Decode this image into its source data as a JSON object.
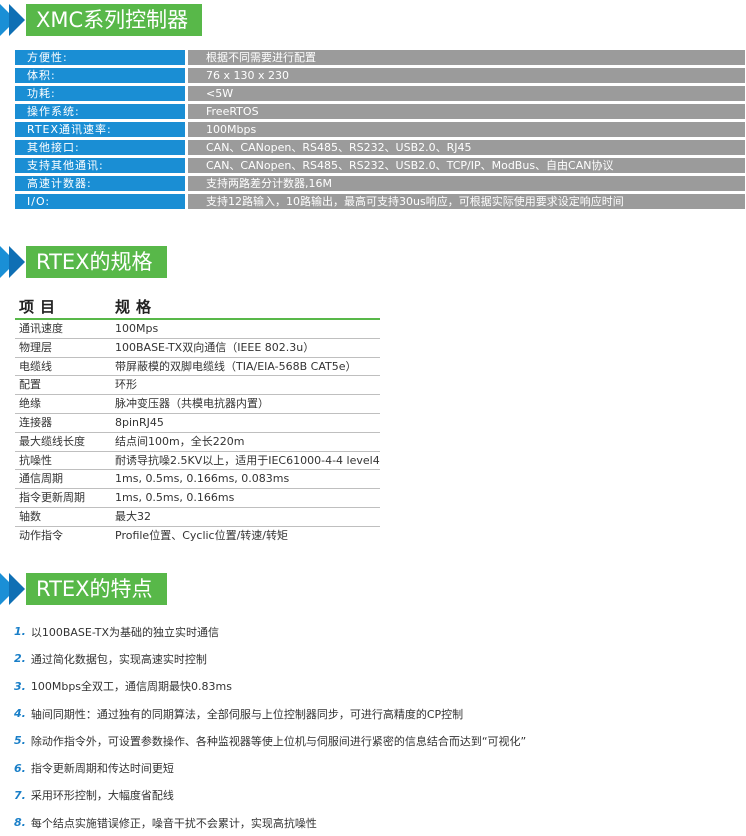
{
  "sections": {
    "xmc_title": "XMC系列控制器",
    "rtex_spec_title": "RTEX的规格",
    "rtex_feature_title": "RTEX的特点"
  },
  "specs": [
    {
      "key": "方便性:",
      "value": "根据不同需要进行配置"
    },
    {
      "key": "体积:",
      "value": "76 x 130 x 230"
    },
    {
      "key": "功耗:",
      "value": "<5W"
    },
    {
      "key": "操作系统:",
      "value": "FreeRTOS"
    },
    {
      "key": "RTEX通讯速率:",
      "value": "100Mbps"
    },
    {
      "key": "其他接口:",
      "value": "CAN、CANopen、RS485、RS232、USB2.0、RJ45"
    },
    {
      "key": "支持其他通讯:",
      "value": "CAN、CANopen、RS485、RS232、USB2.0、TCP/IP、ModBus、自由CAN协议"
    },
    {
      "key": "高速计数器:",
      "value": "支持两路差分计数器,16M"
    },
    {
      "key": "I/O:",
      "value": "支持12路输入，10路输出，最高可支持30us响应，可根据实际使用要求设定响应时间"
    }
  ],
  "rtex_table": {
    "headers": [
      "项目",
      "规格"
    ],
    "rows": [
      [
        "通讯速度",
        "100Mps"
      ],
      [
        "物理层",
        "100BASE-TX双向通信（IEEE 802.3u）"
      ],
      [
        "电缆线",
        "带屏蔽模的双脚电缆线（TIA/EIA-568B CAT5e）"
      ],
      [
        "配置",
        "环形"
      ],
      [
        "绝缘",
        "脉冲变压器（共模电抗器内置）"
      ],
      [
        "连接器",
        "8pinRJ45"
      ],
      [
        "最大缆线长度",
        "结点间100m，全长220m"
      ],
      [
        "抗噪性",
        "耐诱导抗噪2.5KV以上，适用于IEC61000-4-4 level4"
      ],
      [
        "通信周期",
        "1ms, 0.5ms, 0.166ms, 0.083ms"
      ],
      [
        "指令更新周期",
        "1ms, 0.5ms, 0.166ms"
      ],
      [
        "轴数",
        "最大32"
      ],
      [
        "动作指令",
        "Profile位置、Cyclic位置/转速/转矩"
      ]
    ]
  },
  "features": [
    {
      "num": "1.",
      "text": "以100BASE-TX为基础的独立实时通信"
    },
    {
      "num": "2.",
      "text": "通过简化数据包，实现高速实时控制"
    },
    {
      "num": "3.",
      "text": "100Mbps全双工，通信周期最快0.83ms"
    },
    {
      "num": "4.",
      "text": "轴间同期性：通过独有的同期算法，全部伺服与上位控制器同步，可进行高精度的CP控制"
    },
    {
      "num": "5.",
      "text": "除动作指令外，可设置参数操作、各种监视器等使上位机与伺服间进行紧密的信息结合而达到“可视化”"
    },
    {
      "num": "6.",
      "text": "指令更新周期和传达时间更短"
    },
    {
      "num": "7.",
      "text": "采用环形控制，大幅度省配线"
    },
    {
      "num": "8.",
      "text": "每个结点实施错误修正，噪音干扰不会累计，实现高抗噪性"
    }
  ],
  "colors": {
    "accent_blue": "#1a8ed4",
    "accent_green": "#58b849",
    "value_gray": "#9b9b9b"
  }
}
